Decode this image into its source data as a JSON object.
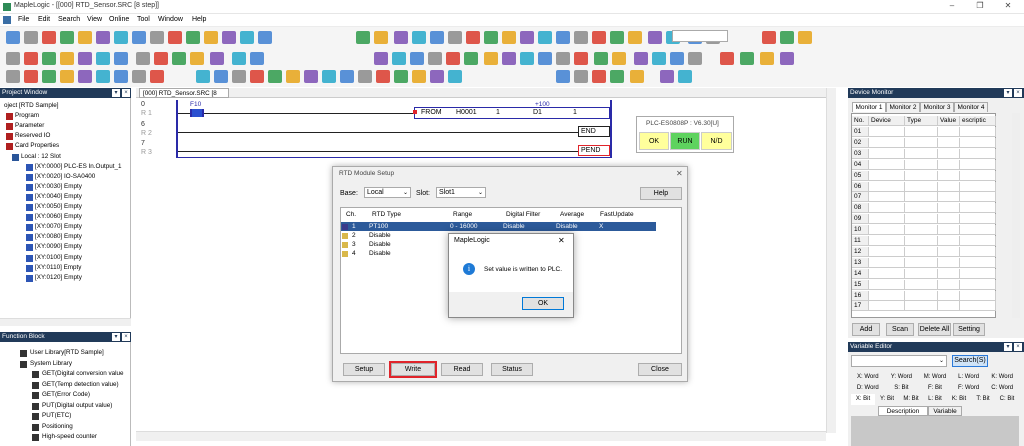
{
  "window": {
    "title": "MapleLogic - [[000] RTD_Sensor.SRC [8 step]]",
    "minimize": "–",
    "restore": "❐",
    "close": "✕"
  },
  "menu": [
    "File",
    "Edit",
    "Search",
    "View",
    "Online",
    "Tool",
    "Window",
    "Help"
  ],
  "project_window": {
    "title": "Project Window",
    "items": [
      "oject [RTD Sample]",
      "Program",
      "Parameter",
      "Reserved IO",
      "Card Properties",
      "Local : 12 Slot",
      "[XY:0000] PLC-ES In.Output_1",
      "[XY:0020] IO-SA0400",
      "[XY:0030] Empty",
      "[XY:0040] Empty",
      "[XY:0050] Empty",
      "[XY:0060] Empty",
      "[XY:0070] Empty",
      "[XY:0080] Empty",
      "[XY:0090] Empty",
      "[XY:0100] Empty",
      "[XY:0110] Empty",
      "[XY:0120] Empty"
    ]
  },
  "function_block": {
    "title": "Function Block",
    "items": [
      "User Library[RTD Sample]",
      "System Library",
      "GET(Digital conversion value",
      "GET(Temp detection value)",
      "GET(Error Code)",
      "PUT(Digital output value)",
      "PUT(ETC)",
      "Positioning",
      "High-speed counter"
    ]
  },
  "editor": {
    "tab": "[000] RTD_Sensor.SRC [8 step]",
    "rungs": [
      {
        "n": "0",
        "s": "R 1"
      },
      {
        "n": "6",
        "s": "R 2"
      },
      {
        "n": "7",
        "s": "R 3"
      }
    ],
    "contact": "F10",
    "from_label": "+100",
    "from": [
      "FROM",
      "H0001",
      "1",
      "D1",
      "1"
    ],
    "end": "END",
    "pend": "PEND"
  },
  "plc_box": {
    "title": "PLC-ES0808P : V6.30[U]",
    "ok": "OK",
    "run": "RUN",
    "nd": "N/D"
  },
  "rtd_dialog": {
    "title": "RTD Module Setup",
    "close": "✕",
    "base_label": "Base:",
    "base_value": "Local",
    "slot_label": "Slot:",
    "slot_value": "Slot1",
    "help": "Help",
    "headers": [
      "Ch.",
      "RTD Type",
      "Range",
      "Digital Filter",
      "Average",
      "FastUpdate"
    ],
    "rows": [
      {
        "ch": "1",
        "type": "PT100",
        "range": "0 - 16000",
        "filter": "Disable",
        "avg": "Disable",
        "fast": "X"
      },
      {
        "ch": "2",
        "type": "Disable",
        "range": "",
        "filter": "",
        "avg": "",
        "fast": ""
      },
      {
        "ch": "3",
        "type": "Disable",
        "range": "",
        "filter": "",
        "avg": "",
        "fast": ""
      },
      {
        "ch": "4",
        "type": "Disable",
        "range": "",
        "filter": "",
        "avg": "",
        "fast": ""
      }
    ],
    "buttons": {
      "setup": "Setup",
      "write": "Write",
      "read": "Read",
      "status": "Status",
      "close": "Close"
    }
  },
  "msgbox": {
    "title": "MapleLogic",
    "close": "✕",
    "text": "Set value is written to PLC.",
    "ok": "OK",
    "icon": "i"
  },
  "device_monitor": {
    "title": "Device Monitor",
    "tabs": [
      "Monitor 1",
      "Monitor 2",
      "Monitor 3",
      "Monitor 4"
    ],
    "headers": [
      "No.",
      "Device",
      "Type",
      "Value",
      "escriptic"
    ],
    "rows": [
      "01",
      "02",
      "03",
      "04",
      "05",
      "06",
      "07",
      "08",
      "09",
      "10",
      "11",
      "12",
      "13",
      "14",
      "15",
      "16",
      "17"
    ],
    "buttons": [
      "Add",
      "Scan",
      "Delete All",
      "Setting"
    ]
  },
  "variable_editor": {
    "title": "Variable Editor",
    "search": "Search(S)",
    "types": [
      [
        "X: Word",
        "Y: Word",
        "M: Word",
        "L: Word",
        "K: Word"
      ],
      [
        "D: Word",
        "S: Bit",
        "F: Bit",
        "F: Word",
        "C: Word"
      ],
      [
        "X: Bit",
        "Y: Bit",
        "M: Bit",
        "L: Bit",
        "K: Bit",
        "T: Bit",
        "C: Bit"
      ]
    ],
    "tabs": [
      "Description",
      "Variable"
    ]
  },
  "colors": {
    "panel_head": "#213a59",
    "accent_blue": "#2a2aa8",
    "highlight_red": "#e0242b",
    "run_green": "#5ed35e",
    "ok_yellow": "#ffff9c"
  }
}
